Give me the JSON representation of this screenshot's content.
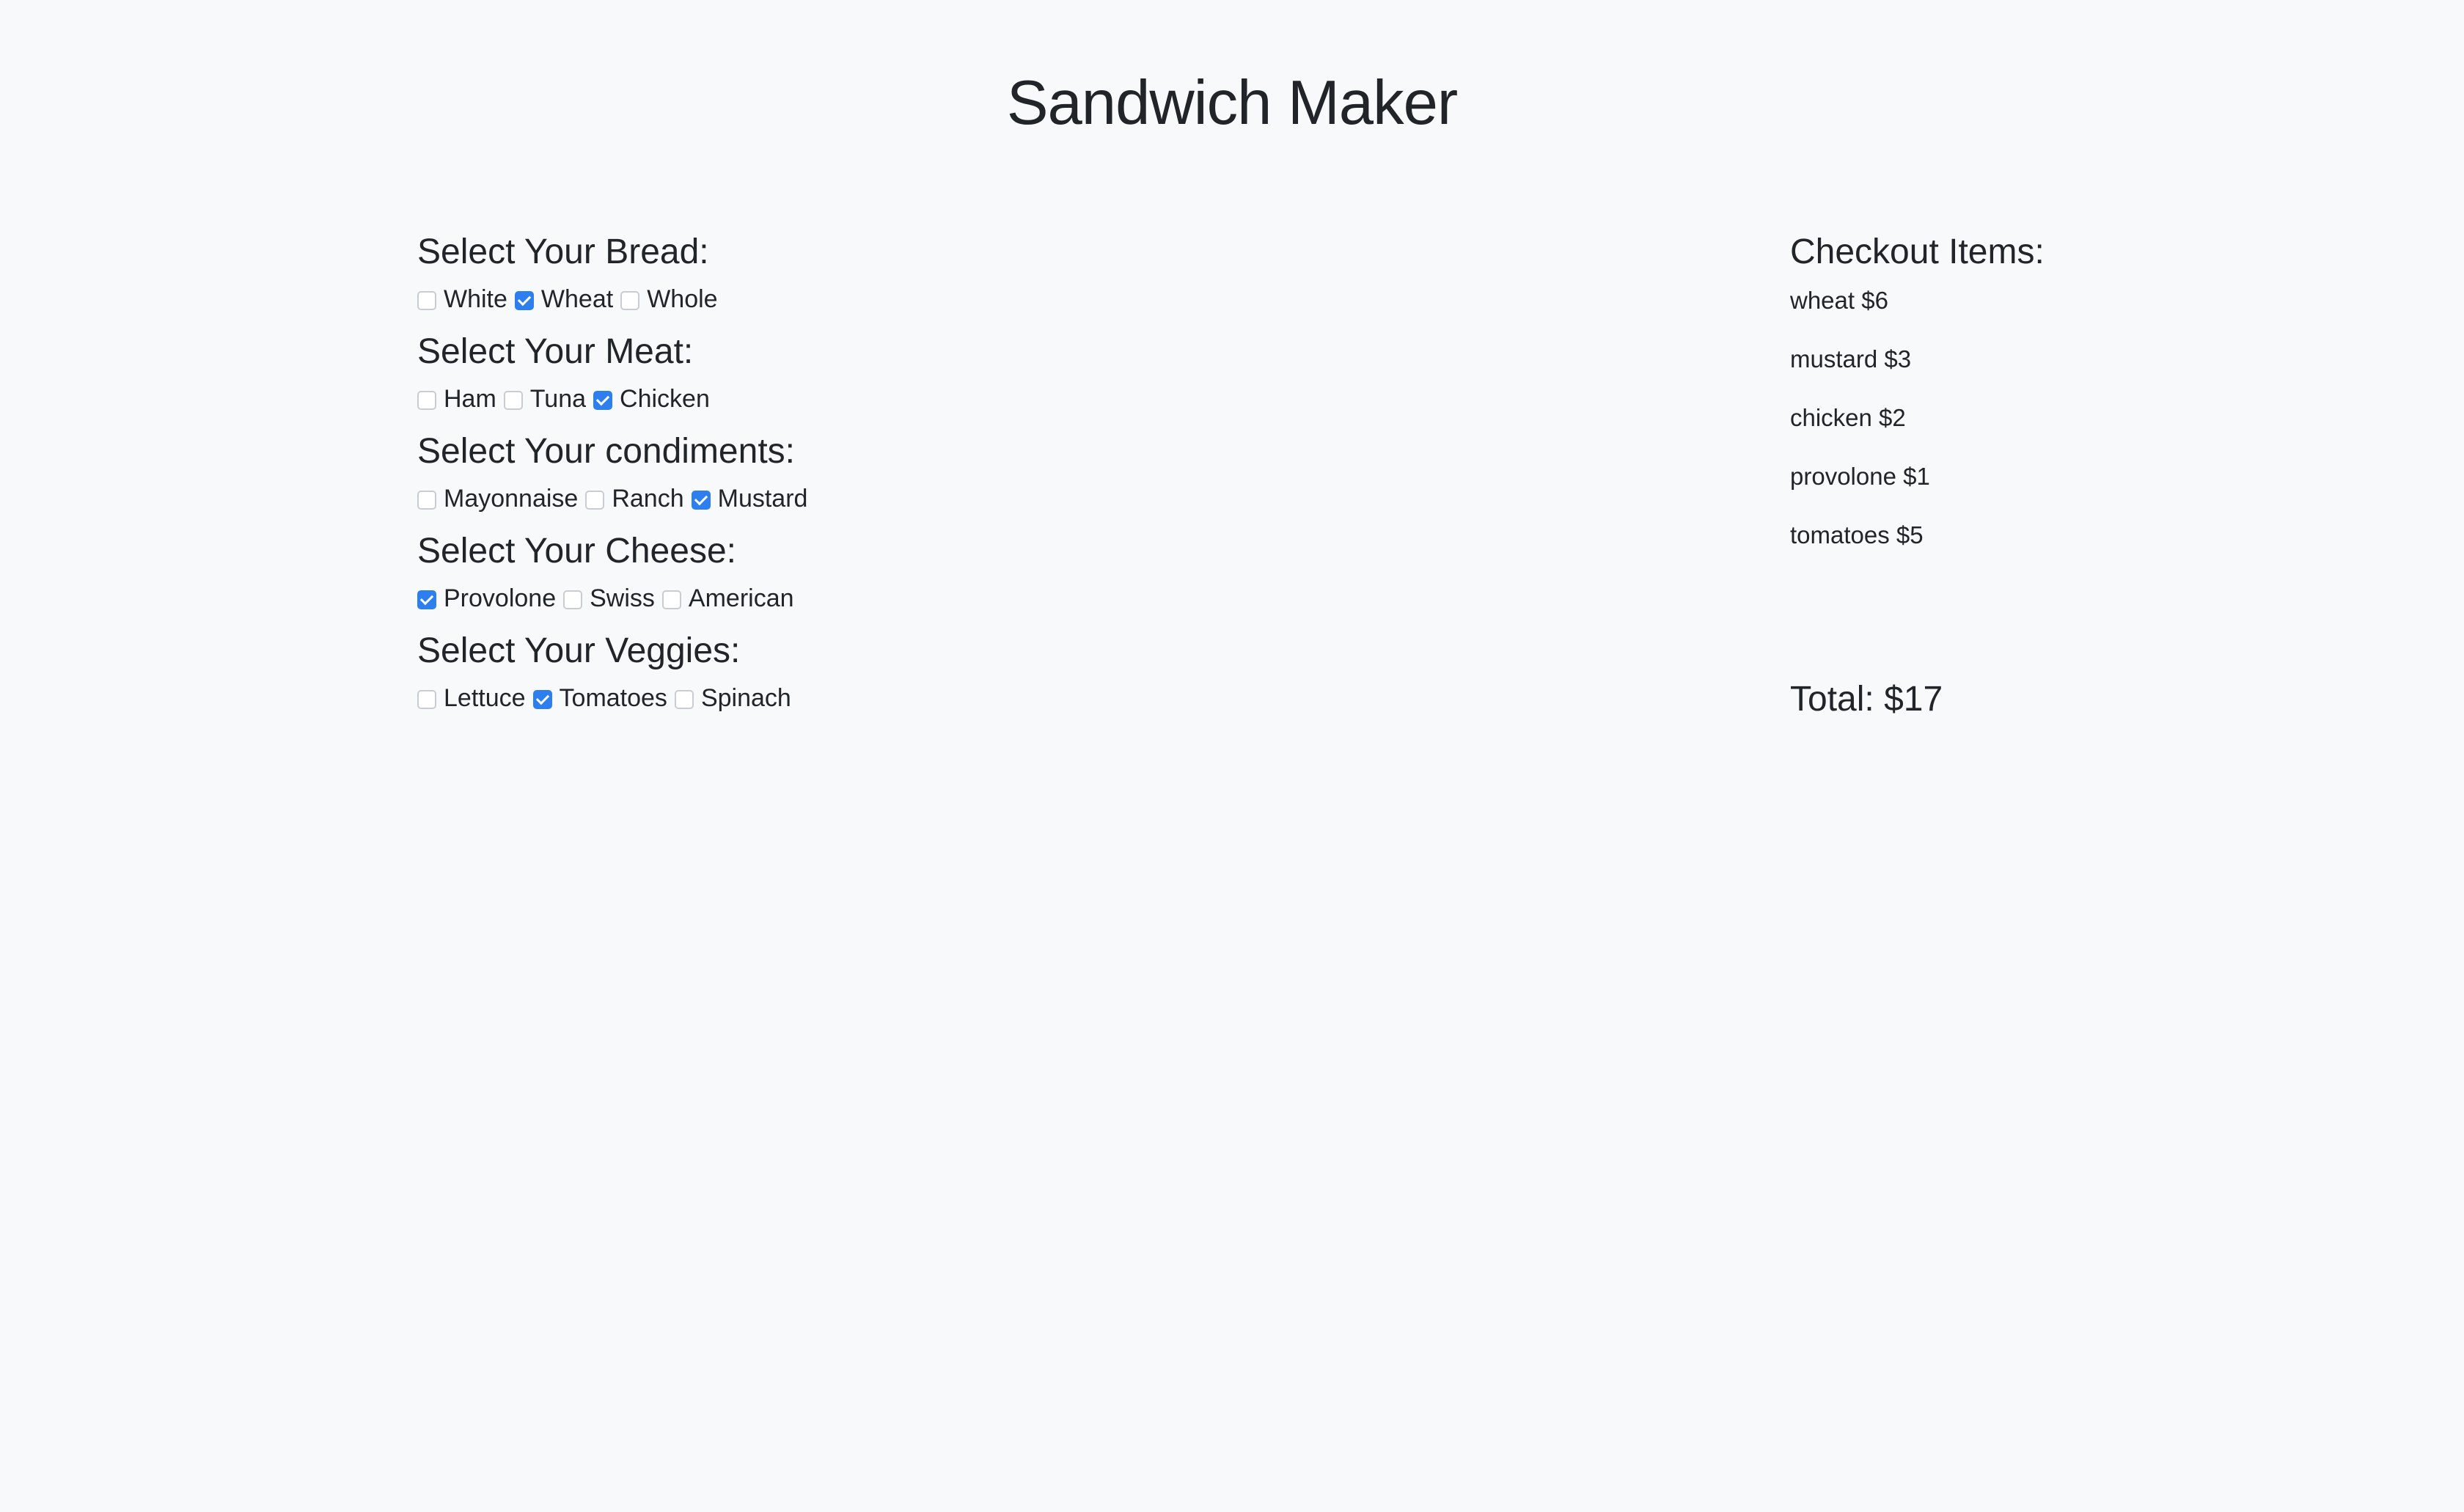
{
  "page": {
    "title": "Sandwich Maker"
  },
  "sections": [
    {
      "heading": "Select Your Bread:",
      "options": [
        {
          "label": "White",
          "checked": false
        },
        {
          "label": "Wheat",
          "checked": true
        },
        {
          "label": "Whole",
          "checked": false
        }
      ]
    },
    {
      "heading": "Select Your Meat:",
      "options": [
        {
          "label": "Ham",
          "checked": false
        },
        {
          "label": "Tuna",
          "checked": false
        },
        {
          "label": "Chicken",
          "checked": true
        }
      ]
    },
    {
      "heading": "Select Your condiments:",
      "options": [
        {
          "label": "Mayonnaise",
          "checked": false
        },
        {
          "label": "Ranch",
          "checked": false
        },
        {
          "label": "Mustard",
          "checked": true
        }
      ]
    },
    {
      "heading": "Select Your Cheese:",
      "options": [
        {
          "label": "Provolone",
          "checked": true
        },
        {
          "label": "Swiss",
          "checked": false
        },
        {
          "label": "American",
          "checked": false
        }
      ]
    },
    {
      "heading": "Select Your Veggies:",
      "options": [
        {
          "label": "Lettuce",
          "checked": false
        },
        {
          "label": "Tomatoes",
          "checked": true
        },
        {
          "label": "Spinach",
          "checked": false
        }
      ]
    }
  ],
  "checkout": {
    "heading": "Checkout Items:",
    "items": [
      "wheat $6",
      "mustard $3",
      "chicken $2",
      "provolone $1",
      "tomatoes $5"
    ],
    "total": "Total: $17"
  },
  "colors": {
    "background": "#f8f9fb",
    "text": "#212529",
    "checkbox_checked": "#2d7ff0",
    "checkbox_border": "#c9ccd0"
  }
}
